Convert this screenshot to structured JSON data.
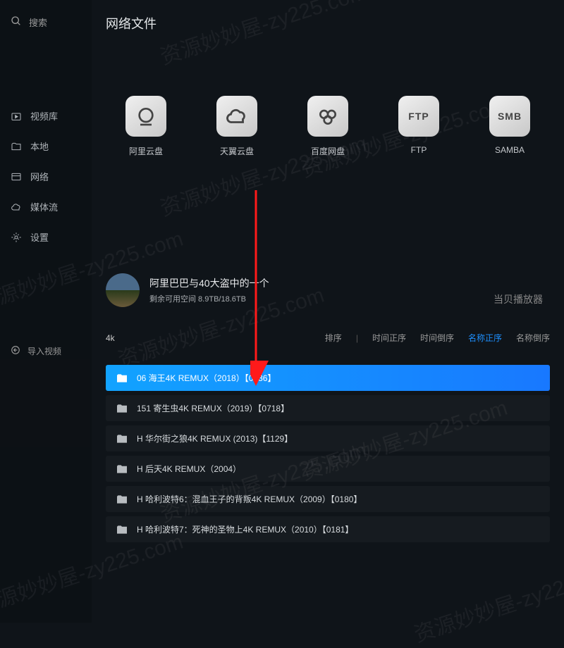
{
  "sidebar": {
    "search": "搜索",
    "nav": [
      {
        "label": "视频库"
      },
      {
        "label": "本地"
      },
      {
        "label": "网络"
      },
      {
        "label": "媒体流"
      },
      {
        "label": "设置"
      }
    ],
    "import": "导入视频"
  },
  "page": {
    "title": "网络文件"
  },
  "clouds": [
    {
      "label": "阿里云盘",
      "icon": "circle"
    },
    {
      "label": "天翼云盘",
      "icon": "cloud"
    },
    {
      "label": "百度网盘",
      "icon": "baidu"
    },
    {
      "label": "FTP",
      "icon": "FTP"
    },
    {
      "label": "SAMBA",
      "icon": "SMB"
    }
  ],
  "user": {
    "name": "阿里巴巴与40大盗中的一个",
    "storage": "剩余可用空间 8.9TB/18.6TB"
  },
  "filter": {
    "current": "4k",
    "sort_label": "排序",
    "options": [
      {
        "label": "时间正序",
        "active": false
      },
      {
        "label": "时间倒序",
        "active": false
      },
      {
        "label": "名称正序",
        "active": true
      },
      {
        "label": "名称倒序",
        "active": false
      }
    ]
  },
  "files": [
    {
      "name": "06 海王4K REMUX（2018）【0536】",
      "selected": true
    },
    {
      "name": "151 寄生虫4K REMUX（2019）【0718】",
      "selected": false
    },
    {
      "name": "H 华尔街之狼4K REMUX (2013)【1129】",
      "selected": false
    },
    {
      "name": "H 后天4K REMUX（2004）",
      "selected": false
    },
    {
      "name": "H 哈利波特6：混血王子的背叛4K REMUX（2009）【0180】",
      "selected": false
    },
    {
      "name": "H 哈利波特7：死神的圣物上4K REMUX（2010）【0181】",
      "selected": false
    }
  ],
  "brand": "当贝播放器",
  "watermark": "资源妙妙屋-zy225.com"
}
